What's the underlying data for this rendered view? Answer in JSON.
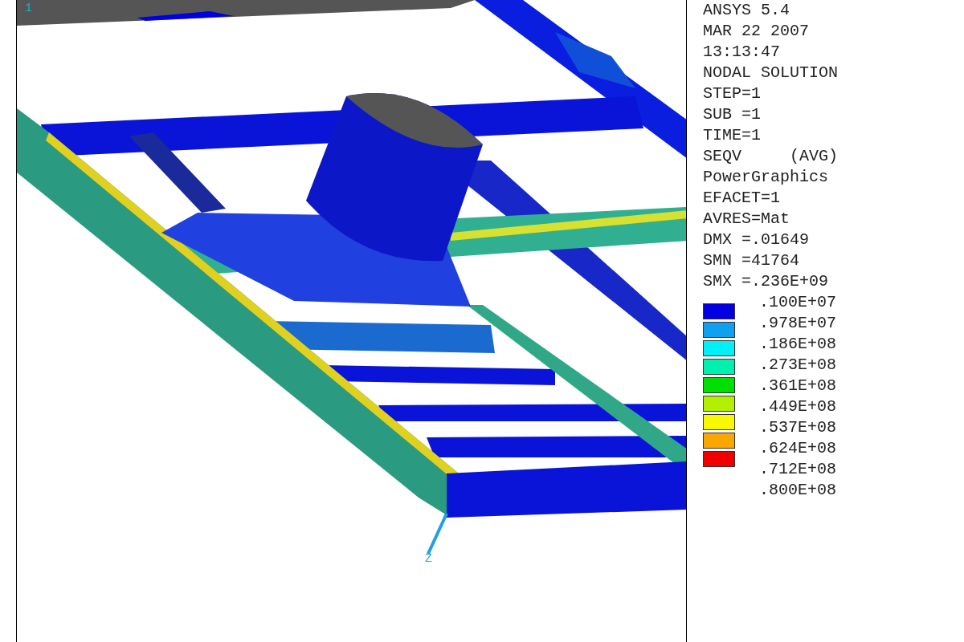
{
  "viewport": {
    "window_number": "1",
    "axis_label": "Z"
  },
  "info_lines": [
    "ANSYS 5.4",
    "MAR 22 2007",
    "13:13:47",
    "NODAL SOLUTION",
    "STEP=1",
    "SUB =1",
    "TIME=1",
    "SEQV     (AVG)",
    "PowerGraphics",
    "EFACET=1",
    "AVRES=Mat",
    "DMX =.01649",
    "SMN =41764",
    "SMX =.236E+09"
  ],
  "contour_legend": {
    "bands": [
      {
        "color": "#0000e0"
      },
      {
        "color": "#10a0f0"
      },
      {
        "color": "#00f0f8"
      },
      {
        "color": "#00f0b0"
      },
      {
        "color": "#00e000"
      },
      {
        "color": "#b0f000"
      },
      {
        "color": "#f8f800"
      },
      {
        "color": "#f8a800"
      },
      {
        "color": "#f00000"
      }
    ],
    "values": [
      ".100E+07",
      ".978E+07",
      ".186E+08",
      ".273E+08",
      ".361E+08",
      ".449E+08",
      ".537E+08",
      ".624E+08",
      ".712E+08",
      ".800E+08"
    ]
  }
}
